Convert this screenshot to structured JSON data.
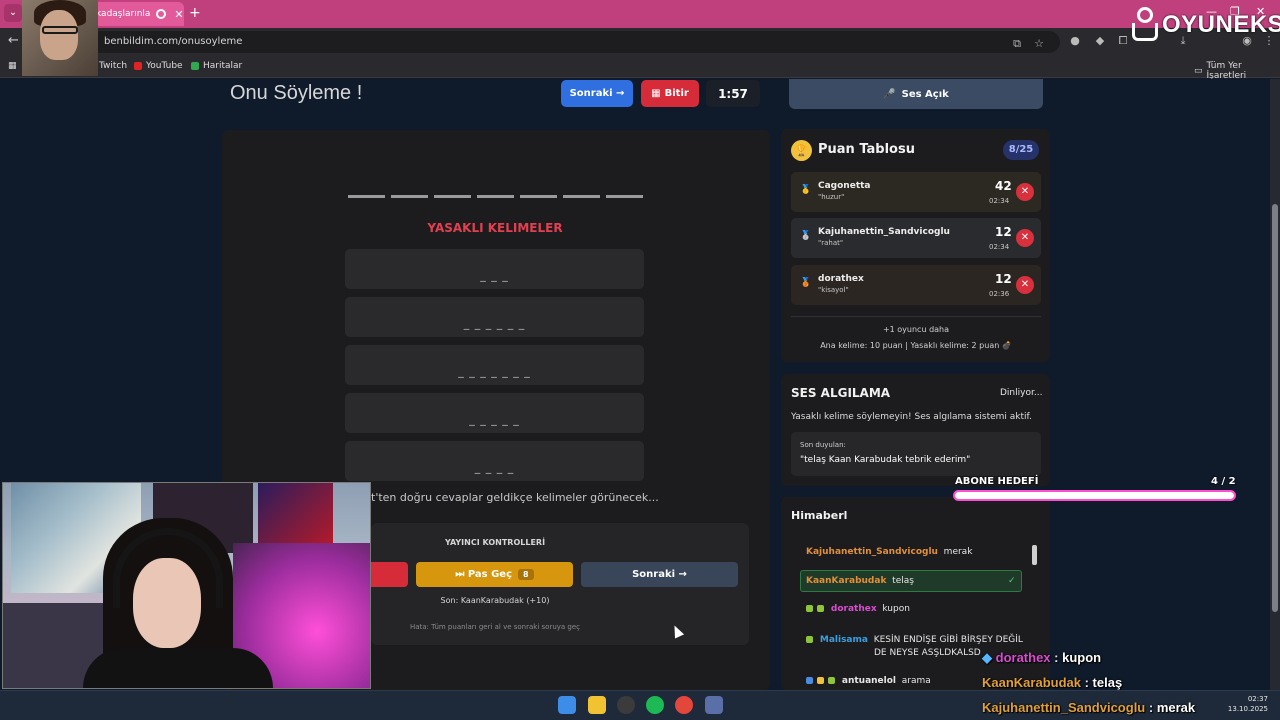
{
  "browser": {
    "tab_title": "kadaşlarınla",
    "new_tab_symbol": "+",
    "tab_close_symbol": "✕",
    "url": "benbildim.com/onusoyleme",
    "bookmarks": [
      "Twitch",
      "YouTube",
      "Haritalar"
    ],
    "bookmarks_right": "Tüm Yer İşaretleri"
  },
  "game": {
    "title": "Onu Söyleme !",
    "next_label": "Sonraki →",
    "finish_label": "Bitir",
    "timer": "1:57",
    "forbidden_title": "YASAKLI KELIMELER",
    "forbidden_masks": [
      "_ _ _",
      "_ _ _ _ _ _",
      "_ _ _ _ _ _ _",
      "_ _ _ _ _",
      "_ _ _ _"
    ],
    "hint": "t'ten doğru cevaplar geldikçe kelimeler görünecek...",
    "controls_title": "YAYINCI KONTROLLERİ",
    "pass_label": "⏭ Pas Geç",
    "pass_count": "8",
    "next2_label": "Sonraki →",
    "last_action": "Son: KaanKarabudak (+10)",
    "error_note": "Hata: Tüm puanları geri al ve sonraki soruya geç"
  },
  "sound": {
    "label": "Ses Açık",
    "icon": "🎤"
  },
  "scoreboard": {
    "title": "Puan Tablosu",
    "count": "8/25",
    "players": [
      {
        "name": "Cagonetta",
        "word": "\"huzur\"",
        "score": "42",
        "time": "02:34",
        "medal": "🥇"
      },
      {
        "name": "Kajuhanettin_Sandvicoglu",
        "word": "\"rahat\"",
        "score": "12",
        "time": "02:34",
        "medal": "🥈"
      },
      {
        "name": "dorathex",
        "word": "\"kisayol\"",
        "score": "12",
        "time": "02:36",
        "medal": "🥉"
      }
    ],
    "more_players": "+1 oyuncu daha",
    "scoring_note": "Ana kelime: 10 puan | Yasaklı kelime: 2 puan 💣"
  },
  "voice": {
    "title": "SES ALGILAMA",
    "status": "Dinliyor...",
    "description": "Yasaklı kelime söylemeyin! Ses algılama sistemi aktif.",
    "heard_label": "Son duyulan:",
    "heard_text": "\"telaş Kaan Karabudak tebrik ederim\""
  },
  "chat": {
    "title": "Himaberl",
    "messages": [
      {
        "user": "Kajuhanettin_Sandvicoglu",
        "text": "merak",
        "color": "#e0903a"
      },
      {
        "user": "KaanKarabudak",
        "text": "telaş",
        "color": "#e0903a",
        "correct": "✓"
      },
      {
        "user": "dorathex",
        "text": "kupon",
        "color": "#d94bd0"
      },
      {
        "user": "Malisama",
        "text": "KESİN ENDİŞE GİBİ BİRŞEY DEĞİL",
        "text2": "DE NEYSE ASŞLDKALSD",
        "color": "#3a9ee0"
      },
      {
        "user": "antuanelol",
        "text": "arama",
        "color": "#e6e6e6"
      }
    ]
  },
  "overlay": {
    "brand": "OYUNEKS",
    "sub_goal_label": "ABONE HEDEFİ",
    "sub_goal_count": "4 / 2",
    "sub_goal_fraction": 1.0,
    "chat": [
      {
        "user": "dorathex",
        "text": "kupon",
        "color": "#d94bd0"
      },
      {
        "user": "KaanKarabudak",
        "text": "telaş",
        "color": "#e0a03a"
      },
      {
        "user": "Kajuhanettin_Sandvicoglu",
        "text": "merak",
        "color": "#e0a03a"
      }
    ]
  },
  "taskbar": {
    "time": "02:37",
    "date": "13.10.2025"
  },
  "colors": {
    "accent_blue": "#2f6fe0",
    "accent_red": "#d62c3a",
    "accent_gold": "#d6960d",
    "page_bg": "#0f1a2b"
  }
}
